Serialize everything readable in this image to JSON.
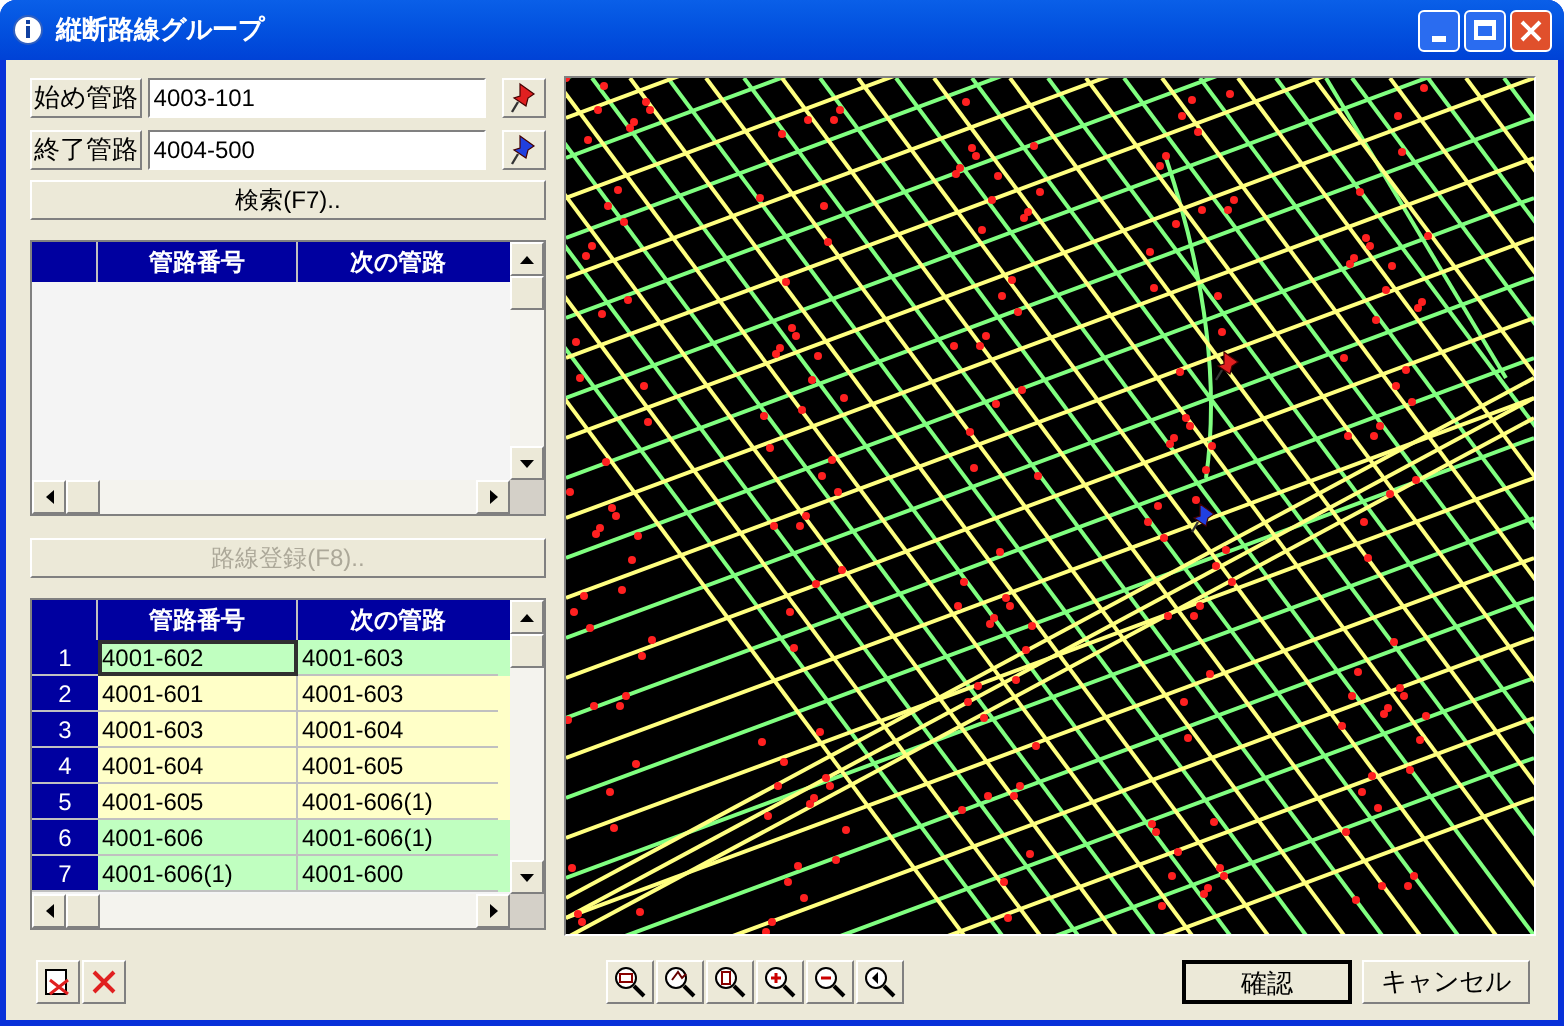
{
  "window": {
    "title": "縦断路線グループ"
  },
  "start_pipe": {
    "label": "始め管路",
    "value": "4003-101"
  },
  "end_pipe": {
    "label": "終了管路",
    "value": "4004-500"
  },
  "search_button": {
    "label": "検索(F7)..",
    "disabled": false
  },
  "search_results": {
    "columns": [
      "管路番号",
      "次の管路"
    ]
  },
  "register_button": {
    "label": "路線登録(F8)..",
    "disabled": true
  },
  "route_table": {
    "columns": [
      "管路番号",
      "次の管路"
    ],
    "rows": [
      {
        "index": "1",
        "pipe": "4001-602",
        "next": "4001-603",
        "color": "#c0ffc0",
        "selected": true
      },
      {
        "index": "2",
        "pipe": "4001-601",
        "next": "4001-603",
        "color": "#ffffc8",
        "selected": false
      },
      {
        "index": "3",
        "pipe": "4001-603",
        "next": "4001-604",
        "color": "#ffffc8",
        "selected": false
      },
      {
        "index": "4",
        "pipe": "4001-604",
        "next": "4001-605",
        "color": "#ffffc8",
        "selected": false
      },
      {
        "index": "5",
        "pipe": "4001-605",
        "next": "4001-606(1)",
        "color": "#ffffc8",
        "selected": false
      },
      {
        "index": "6",
        "pipe": "4001-606",
        "next": "4001-606(1)",
        "color": "#c0ffc0",
        "selected": false
      },
      {
        "index": "7",
        "pipe": "4001-606(1)",
        "next": "4001-600",
        "color": "#c0ffc0",
        "selected": false
      }
    ]
  },
  "ok_button": {
    "label": "確認"
  },
  "cancel_button": {
    "label": "キャンセル"
  }
}
